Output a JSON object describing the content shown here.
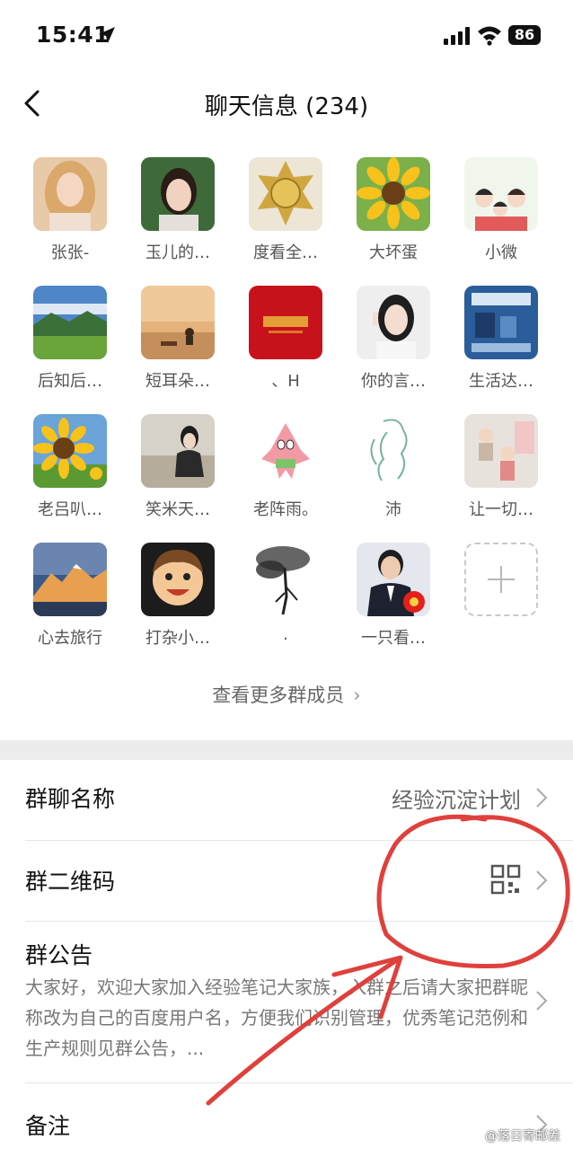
{
  "status": {
    "time": "15:41",
    "battery": "86"
  },
  "nav": {
    "title": "聊天信息 (234)"
  },
  "members": [
    {
      "name": "张张-",
      "avatar": "portrait-blonde"
    },
    {
      "name": "玉儿的…",
      "avatar": "portrait-girl"
    },
    {
      "name": "度看全…",
      "avatar": "gold-badge"
    },
    {
      "name": "大坏蛋",
      "avatar": "sunflower"
    },
    {
      "name": "小微",
      "avatar": "cartoon-family"
    },
    {
      "name": "后知后…",
      "avatar": "mountain-field"
    },
    {
      "name": "短耳朵…",
      "avatar": "sunset-beach"
    },
    {
      "name": "、H",
      "avatar": "red-card"
    },
    {
      "name": "你的言…",
      "avatar": "portrait-peace"
    },
    {
      "name": "生活达…",
      "avatar": "blue-product"
    },
    {
      "name": "老吕叭…",
      "avatar": "sunflower"
    },
    {
      "name": "笑米天…",
      "avatar": "portrait-sitting"
    },
    {
      "name": "老阵雨。",
      "avatar": "starfish-cartoon"
    },
    {
      "name": "沛",
      "avatar": "line-sketch"
    },
    {
      "name": "让一切…",
      "avatar": "kids-room"
    },
    {
      "name": "心去旅行",
      "avatar": "snow-mountain"
    },
    {
      "name": "打杂小…",
      "avatar": "cartoon-boy"
    },
    {
      "name": ".",
      "avatar": "ink-tree"
    },
    {
      "name": "一只看…",
      "avatar": "suit-man"
    }
  ],
  "add_member_icon": "plus-icon",
  "more_members": "查看更多群成员",
  "rows": {
    "group_name": {
      "label": "群聊名称",
      "value": "经验沉淀计划"
    },
    "qr_code": {
      "label": "群二维码",
      "icon": "qr-code-icon"
    },
    "notice": {
      "label": "群公告",
      "text": "大家好，欢迎大家加入经验笔记大家族，入群之后请大家把群昵称改为自己的百度用户名，方便我们识别管理，优秀笔记范例和生产规则见群公告，..."
    },
    "remark": {
      "label": "备注"
    }
  },
  "watermark": "@落日寄邮差",
  "colors": {
    "annotation_red": "#e0403c",
    "divider": "#ececec"
  }
}
